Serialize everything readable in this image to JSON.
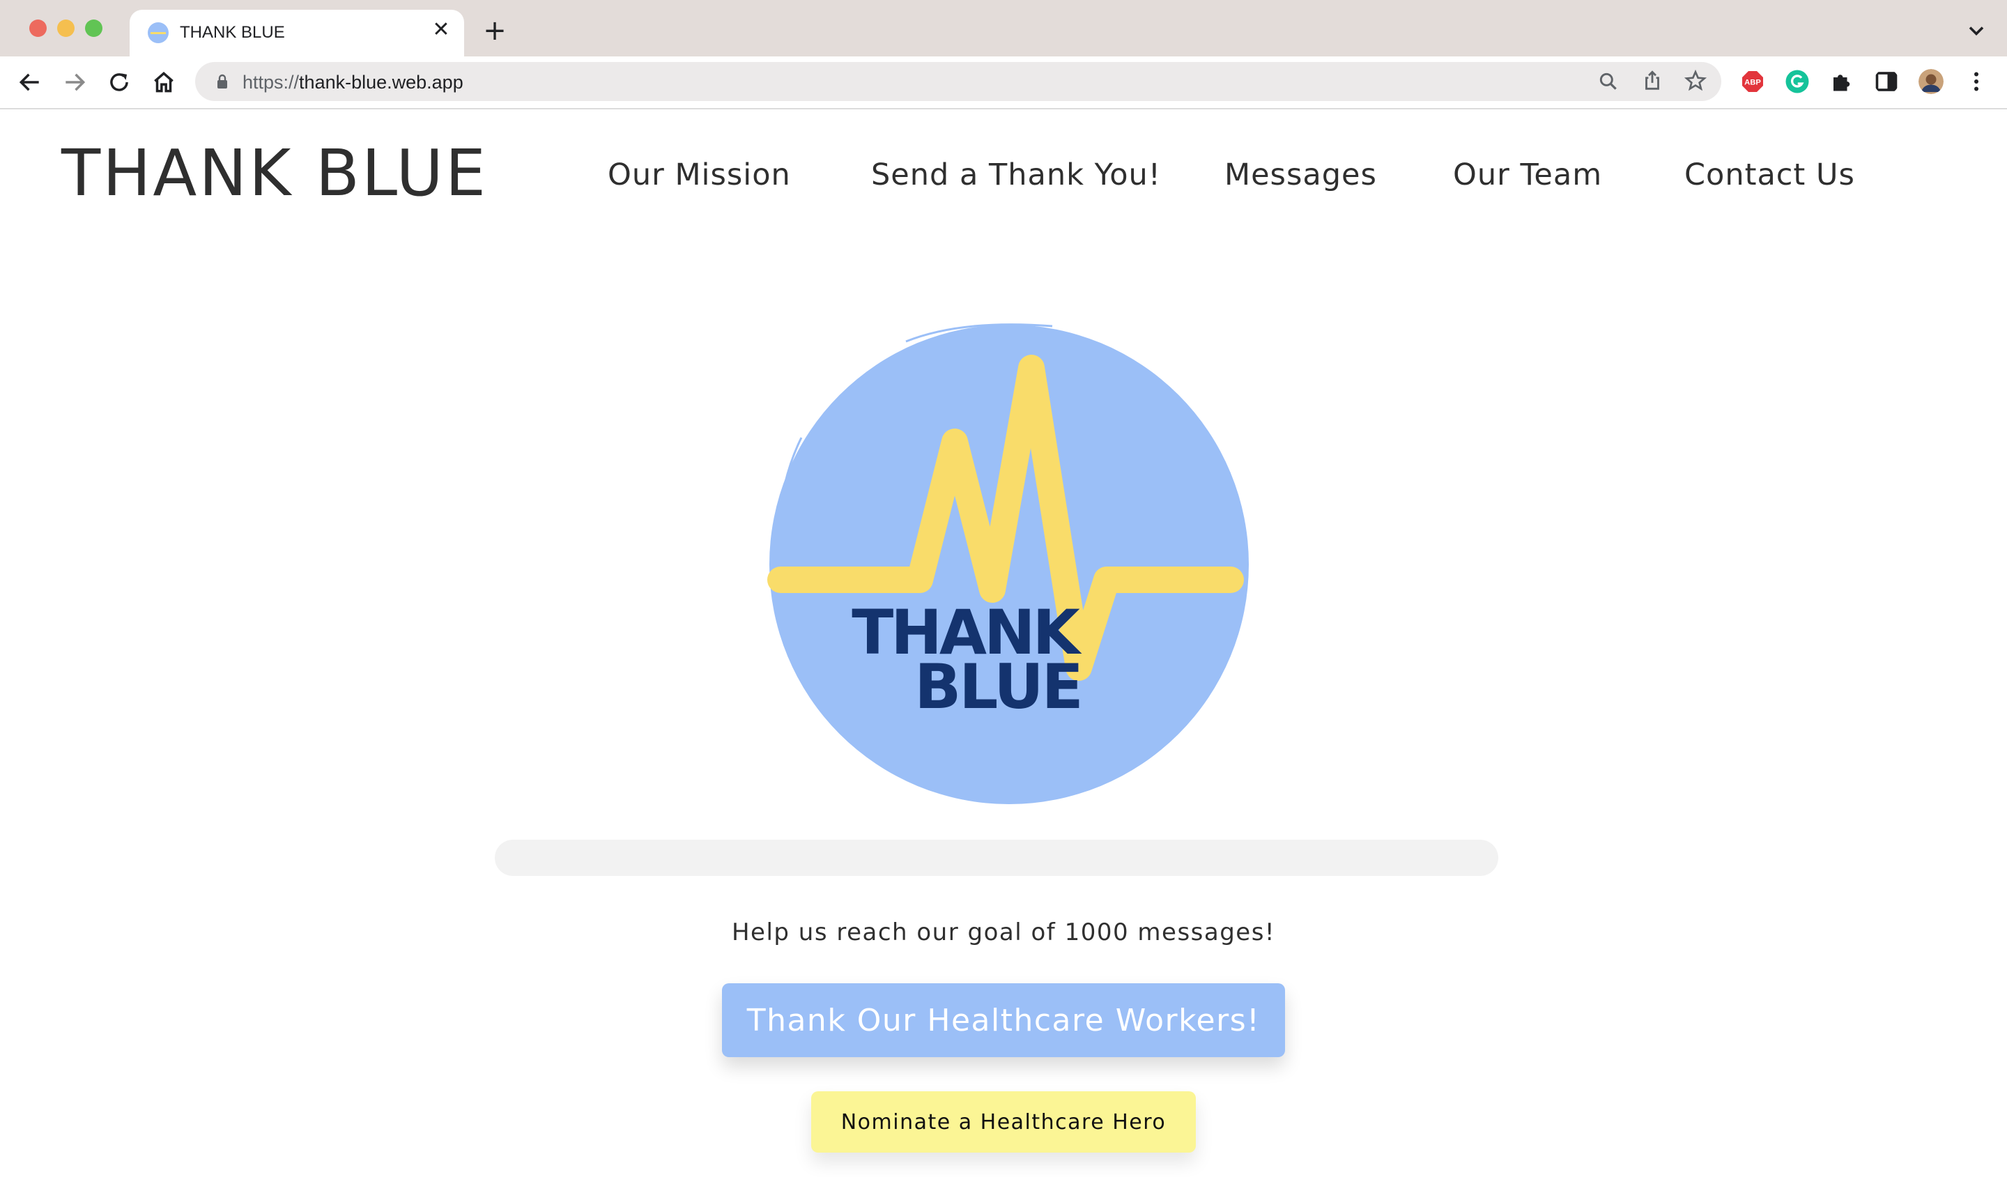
{
  "browser": {
    "tab_title": "THANK BLUE",
    "url_scheme": "https://",
    "url_host": "thank-blue.web.app",
    "icons": [
      "back-icon",
      "forward-icon",
      "reload-icon",
      "home-icon",
      "lock-icon",
      "zoom-icon",
      "share-icon",
      "bookmark-star-icon",
      "extensions-icon",
      "side-panel-icon",
      "menu-icon"
    ],
    "extensions": [
      "adblock-plus-extension",
      "grammarly-extension"
    ]
  },
  "site": {
    "logo_text": "THANK BLUE",
    "nav": [
      "Our Mission",
      "Send a Thank You!",
      "Messages",
      "Our Team",
      "Contact Us"
    ]
  },
  "hero": {
    "logo_text_line1": "THANK",
    "logo_text_line2": "BLUE",
    "progress_value": 0,
    "goal_text": "Help us reach our goal of 1000 messages!",
    "primary_button": "Thank Our Healthcare Workers!",
    "secondary_button": "Nominate a Healthcare Hero"
  },
  "colors": {
    "brand_blue": "#9bbff7",
    "brand_yellow": "#f9dc6a",
    "logo_text_navy": "#14336e",
    "secondary_button_yellow": "#fbf595"
  }
}
